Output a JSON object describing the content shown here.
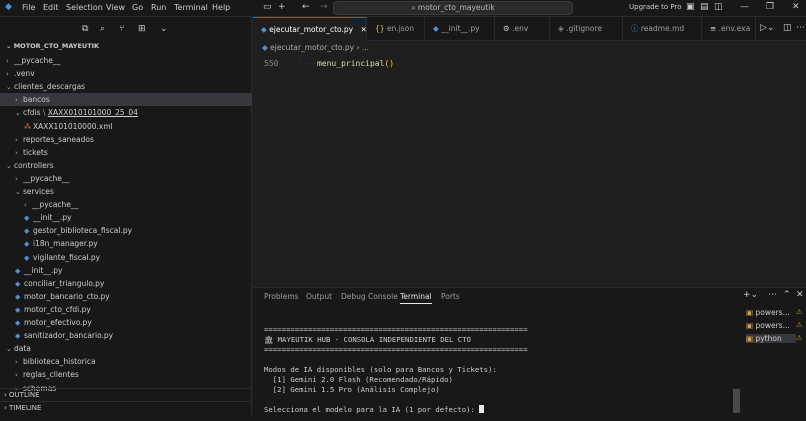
{
  "titlebar": {
    "menu": [
      "File",
      "Edit",
      "Selection",
      "View",
      "Go",
      "Run",
      "Terminal",
      "Help"
    ],
    "search": "motor_cto_mayeutik",
    "upgrade": "Upgrade to Pro"
  },
  "explorer": {
    "root": "MOTOR_CTO_MAYEUTIK",
    "items": [
      {
        "label": "__pycache__",
        "kind": "folder",
        "open": false,
        "indent": 0
      },
      {
        "label": ".venv",
        "kind": "folder",
        "open": false,
        "indent": 0
      },
      {
        "label": "clientes_descargas",
        "kind": "folder",
        "open": true,
        "indent": 0
      },
      {
        "label": "bancos",
        "kind": "folder",
        "open": false,
        "indent": 1,
        "selected": true
      },
      {
        "label": "cfdis",
        "suffix": "XAXX010101000_25_04",
        "kind": "folder",
        "open": true,
        "indent": 1
      },
      {
        "label": "XAXX101010000.xml",
        "kind": "xml",
        "indent": 2
      },
      {
        "label": "reportes_saneados",
        "kind": "folder",
        "open": false,
        "indent": 1
      },
      {
        "label": "tickets",
        "kind": "folder",
        "open": false,
        "indent": 1
      },
      {
        "label": "controllers",
        "kind": "folder",
        "open": true,
        "indent": 0
      },
      {
        "label": "__pycache__",
        "kind": "folder",
        "open": false,
        "indent": 1
      },
      {
        "label": "services",
        "kind": "folder",
        "open": true,
        "indent": 1
      },
      {
        "label": "__pycache__",
        "kind": "folder",
        "open": false,
        "indent": 2
      },
      {
        "label": "__init__.py",
        "kind": "py",
        "indent": 2
      },
      {
        "label": "gestor_biblioteca_fiscal.py",
        "kind": "py",
        "indent": 2
      },
      {
        "label": "i18n_manager.py",
        "kind": "py",
        "indent": 2
      },
      {
        "label": "vigilante_fiscal.py",
        "kind": "py",
        "indent": 2
      },
      {
        "label": "__init__.py",
        "kind": "py",
        "indent": 1
      },
      {
        "label": "conciliar_triangulo.py",
        "kind": "py",
        "indent": 1
      },
      {
        "label": "motor_bancario_cto.py",
        "kind": "py",
        "indent": 1
      },
      {
        "label": "motor_cto_cfdi.py",
        "kind": "py",
        "indent": 1
      },
      {
        "label": "motor_efectivo.py",
        "kind": "py",
        "indent": 1
      },
      {
        "label": "sanitizador_bancario.py",
        "kind": "py",
        "indent": 1
      },
      {
        "label": "data",
        "kind": "folder",
        "open": true,
        "indent": 0
      },
      {
        "label": "biblioteca_historica",
        "kind": "folder",
        "open": false,
        "indent": 1
      },
      {
        "label": "reglas_clientes",
        "kind": "folder",
        "open": false,
        "indent": 1
      },
      {
        "label": "schemas",
        "kind": "folder",
        "open": false,
        "indent": 1
      }
    ],
    "outline": "OUTLINE",
    "timeline": "TIMELINE"
  },
  "tabs": [
    {
      "label": "ejecutar_motor_cto.py",
      "icon": "python-icon",
      "active": true,
      "closable": true
    },
    {
      "label": "en.json",
      "icon": "json-icon"
    },
    {
      "label": "__init__.py",
      "icon": "python-icon"
    },
    {
      "label": ".env",
      "icon": "gear-icon"
    },
    {
      "label": ".gitignore",
      "icon": "git-icon"
    },
    {
      "label": "readme.md",
      "icon": "info-icon"
    },
    {
      "label": ".env.exa",
      "icon": "list-icon"
    }
  ],
  "editor": {
    "breadcrumb": [
      "ejecutar_motor_cto.py",
      "..."
    ],
    "line_number": "550",
    "code": "menu_principal",
    "code_parens": "()"
  },
  "panel": {
    "tabs": [
      "Problems",
      "Output",
      "Debug Console",
      "Terminal",
      "Ports"
    ],
    "active_tab": "Terminal",
    "terminal_lines": [
      "============================================================",
      "🏛 MAYEUTIK HUB - CONSOLA INDEPENDIENTE DEL CTO",
      "============================================================",
      "",
      "Modos de IA disponibles (solo para Bancos y Tickets):",
      "  [1] Gemini 2.0 Flash (Recomendado/Rápido)",
      "  [2] Gemini 1.5 Pro (Análisis Complejo)",
      "",
      "Selecciona el modelo para la IA (1 por defecto): "
    ],
    "terminals": [
      {
        "label": "powers...",
        "warn": true
      },
      {
        "label": "powers...",
        "warn": true
      },
      {
        "label": "python",
        "warn": true,
        "active": true
      }
    ]
  },
  "colors": {
    "accent": "#0078d4",
    "background": "#1f1f1f",
    "sidebar": "#181818"
  }
}
